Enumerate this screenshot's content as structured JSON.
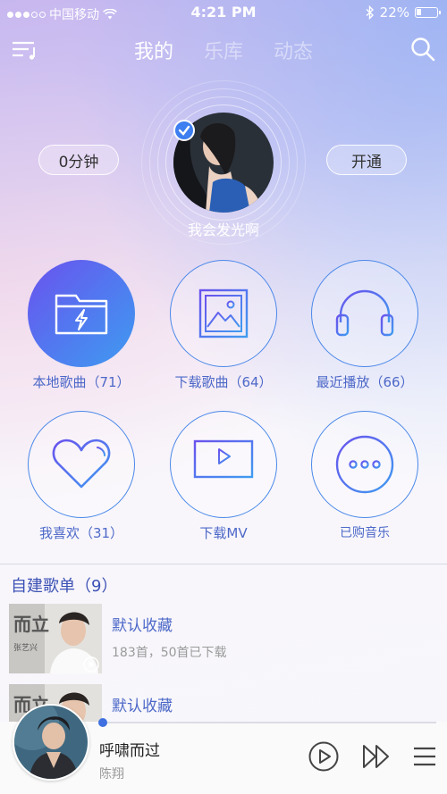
{
  "status_bar": {
    "carrier": "中国移动",
    "time": "4:21 PM",
    "battery": "22%"
  },
  "header": {
    "tabs": [
      {
        "label": "我的",
        "active": true
      },
      {
        "label": "乐库",
        "active": false
      },
      {
        "label": "动态",
        "active": false
      }
    ]
  },
  "profile": {
    "username": "我会发光啊",
    "listen_time": "0分钟",
    "open_vip": "开通"
  },
  "grid": [
    {
      "label": "本地歌曲（71）",
      "icon": "folder-icon"
    },
    {
      "label": "下载歌曲（64）",
      "icon": "image-icon"
    },
    {
      "label": "最近播放（66）",
      "icon": "headphones-icon"
    },
    {
      "label": "我喜欢（31）",
      "icon": "heart-icon"
    },
    {
      "label": "下载MV",
      "icon": "monitor-play-icon"
    },
    {
      "label": "已购音乐",
      "icon": "more-dots-icon"
    }
  ],
  "playlists": {
    "title": "自建歌单（9）",
    "items": [
      {
        "name": "默认收藏",
        "sub": "183首，50首已下载",
        "cover_text": "而立",
        "cover_sub": "张艺兴"
      },
      {
        "name": "默认收藏",
        "cover_text": "而立"
      }
    ]
  },
  "player": {
    "song": "呼啸而过",
    "artist": "陈翔",
    "progress": 0.0
  },
  "colors": {
    "accent": "#4d68c8",
    "accent_blue": "#3f6fe0"
  }
}
